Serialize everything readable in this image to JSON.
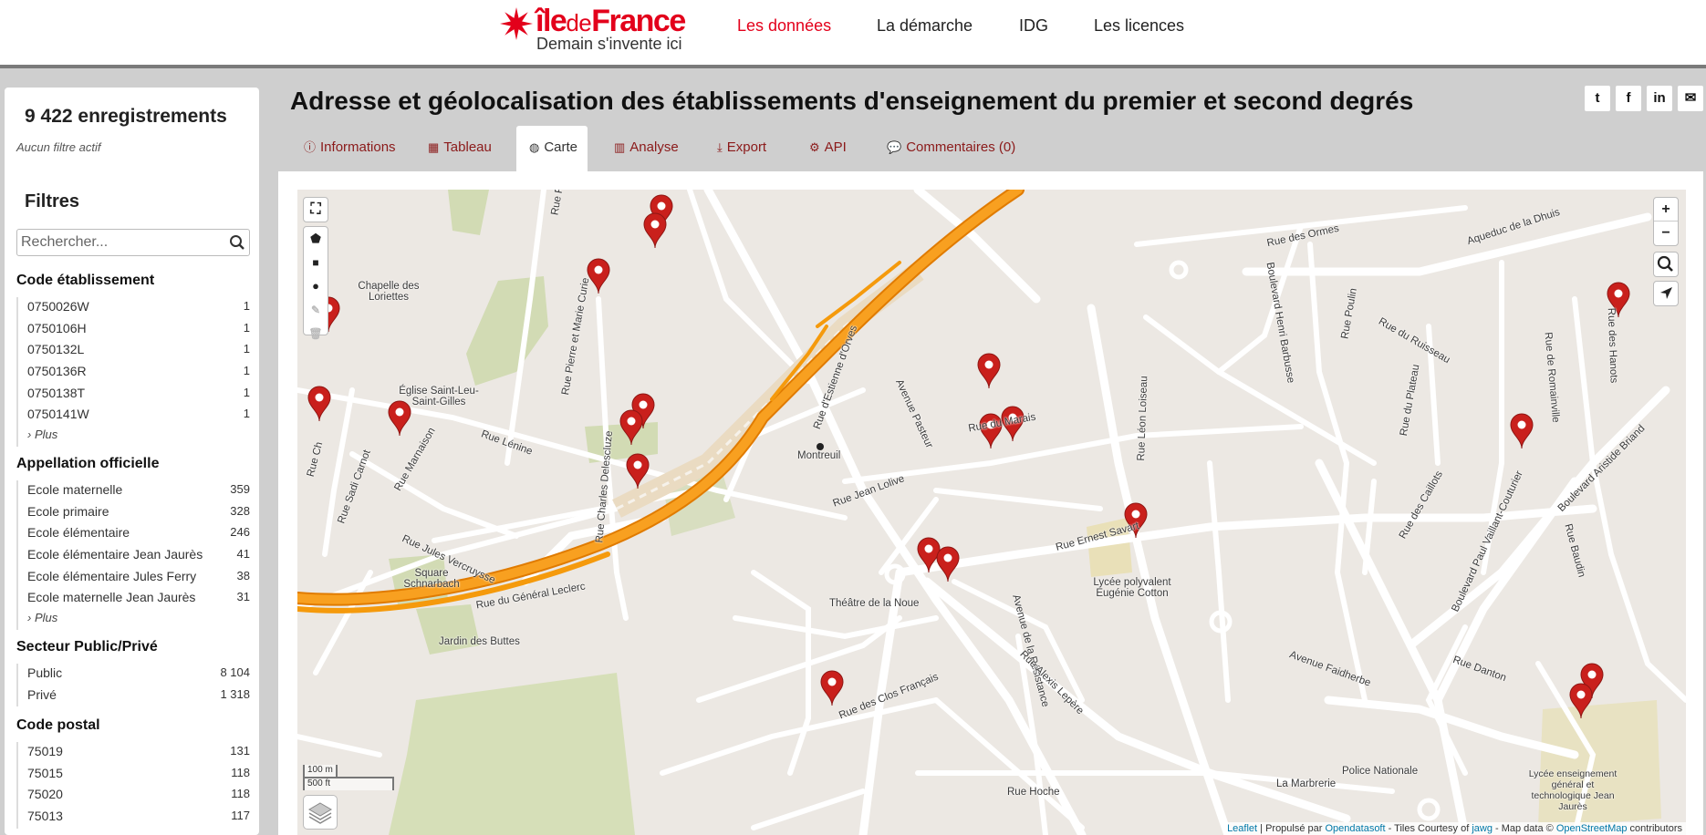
{
  "header": {
    "logo": {
      "main": "île",
      "de": "de",
      "france": "France",
      "tagline": "Demain s'invente ici"
    },
    "nav": [
      {
        "label": "Les données",
        "active": true
      },
      {
        "label": "La démarche",
        "active": false
      },
      {
        "label": "IDG",
        "active": false
      },
      {
        "label": "Les licences",
        "active": false
      }
    ]
  },
  "sidebar": {
    "record_count": "9 422 enregistrements",
    "no_filter": "Aucun filtre actif",
    "filters_title": "Filtres",
    "search_placeholder": "Rechercher...",
    "more_label": "› Plus",
    "groups": [
      {
        "title": "Code établissement",
        "items": [
          {
            "label": "0750026W",
            "count": "1"
          },
          {
            "label": "0750106H",
            "count": "1"
          },
          {
            "label": "0750132L",
            "count": "1"
          },
          {
            "label": "0750136R",
            "count": "1"
          },
          {
            "label": "0750138T",
            "count": "1"
          },
          {
            "label": "0750141W",
            "count": "1"
          }
        ],
        "more": true
      },
      {
        "title": "Appellation officielle",
        "items": [
          {
            "label": "Ecole maternelle",
            "count": "359"
          },
          {
            "label": "Ecole primaire",
            "count": "328"
          },
          {
            "label": "Ecole élémentaire",
            "count": "246"
          },
          {
            "label": "Ecole élémentaire Jean Jaurès",
            "count": "41"
          },
          {
            "label": "Ecole élémentaire Jules Ferry",
            "count": "38"
          },
          {
            "label": "Ecole maternelle Jean Jaurès",
            "count": "31"
          }
        ],
        "more": true
      },
      {
        "title": "Secteur Public/Privé",
        "items": [
          {
            "label": "Public",
            "count": "8 104"
          },
          {
            "label": "Privé",
            "count": "1 318"
          }
        ],
        "more": false
      },
      {
        "title": "Code postal",
        "items": [
          {
            "label": "75019",
            "count": "131"
          },
          {
            "label": "75015",
            "count": "118"
          },
          {
            "label": "75020",
            "count": "118"
          },
          {
            "label": "75013",
            "count": "117"
          }
        ],
        "more": false
      }
    ]
  },
  "dataset": {
    "title": "Adresse et géolocalisation des établissements d'enseignement du premier et second degrés"
  },
  "share": [
    "twitter-icon",
    "facebook-icon",
    "linkedin-icon",
    "email-icon"
  ],
  "tabs": [
    {
      "label": "Informations",
      "icon": "info-icon",
      "glyph": "ⓘ",
      "active": false
    },
    {
      "label": "Tableau",
      "icon": "table-icon",
      "glyph": "▦",
      "active": false
    },
    {
      "label": "Carte",
      "icon": "globe-icon",
      "glyph": "◍",
      "active": true
    },
    {
      "label": "Analyse",
      "icon": "chart-icon",
      "glyph": "▥",
      "active": false
    },
    {
      "label": "Export",
      "icon": "download-icon",
      "glyph": "⤓",
      "active": false
    },
    {
      "label": "API",
      "icon": "cogs-icon",
      "glyph": "⚙",
      "active": false
    },
    {
      "label": "Commentaires (0)",
      "icon": "comments-icon",
      "glyph": "💬",
      "active": false
    }
  ],
  "map": {
    "zoom_in": "+",
    "zoom_out": "−",
    "scale_m": "100 m",
    "scale_ft": "500 ft",
    "labels": [
      "Chapelle des Loriettes",
      "Église Saint-Leu-Saint-Gilles",
      "Rue Lénine",
      "Rue Pierre et Marie Curie",
      "Rue Marnaison",
      "Rue Sadi Carnot",
      "Rue Jules Vercruysse",
      "Square Schnarbach",
      "Rue du Général Leclerc",
      "Jardin des Buttes",
      "Rue Charles Delescluze",
      "Montreuil",
      "Rue d'Estienne d'Orves",
      "Avenue Pasteur",
      "Rue Jean Lolive",
      "Théâtre de la Noue",
      "Rue des Clos Français",
      "Rue Hoche",
      "Rue du Marais",
      "Rue Ernest Savart",
      "Lycée polyvalent Eugénie Cotton",
      "Avenue de la Résistance",
      "Rue Alexis Lepère",
      "Rue Léon Loiseau",
      "Boulevard Henri Barbusse",
      "Rue Poulin",
      "Rue des Ormes",
      "Rue du Ruisseau",
      "Rue du Plateau",
      "Rue des Caillots",
      "Boulevard Paul Vaillant-Couturier",
      "Avenue Faidherbe",
      "Rue Danton",
      "Rue Baudin",
      "Boulevard Aristide Briand",
      "Rue de Romainville",
      "Rue des Hanots",
      "Aqueduc de la Dhuis",
      "La Marbrerie",
      "Police Nationale",
      "Lycée enseignement général et technologique Jean Jaurès",
      "Rue Pi",
      "Rue Ch"
    ],
    "attribution": {
      "leaflet": "Leaflet",
      "sep1": " | Propulsé par ",
      "ods": "Opendatasoft",
      "tiles": " - Tiles Courtesy of ",
      "jawg": "jawg",
      "data": " - Map data © ",
      "osm": "OpenStreetMap",
      "contrib": " contributors"
    }
  },
  "colors": {
    "brand": "#e3001b",
    "tab_text": "#8b1a1a",
    "marker": "#c9201c",
    "highway": "#f59a0c"
  }
}
